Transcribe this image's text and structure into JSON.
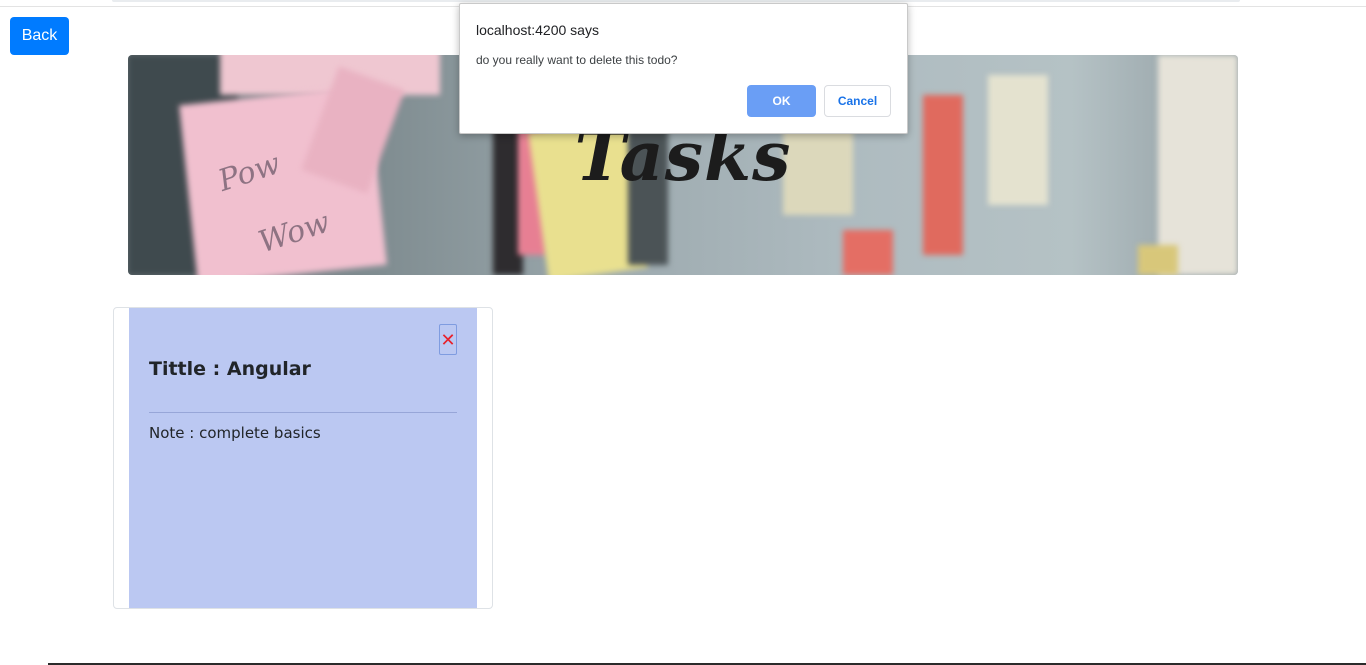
{
  "nav": {
    "back_label": "Back"
  },
  "banner": {
    "title": "Tasks",
    "note_text_1": "Pow",
    "note_text_2": "Wow"
  },
  "todos": [
    {
      "title": "Tittle : Angular",
      "note": "Note : complete basics",
      "delete_symbol": "✕"
    }
  ],
  "dialog": {
    "origin": "localhost:4200 says",
    "message": "do you really want to delete this todo?",
    "ok_label": "OK",
    "cancel_label": "Cancel"
  },
  "colors": {
    "primary": "#007bff",
    "card_background": "#bbc8f2",
    "delete_icon": "#e8212b",
    "dialog_ok": "#6a9ef5",
    "dialog_cancel_text": "#1a73e8"
  },
  "icons": {
    "delete": "close-icon"
  }
}
